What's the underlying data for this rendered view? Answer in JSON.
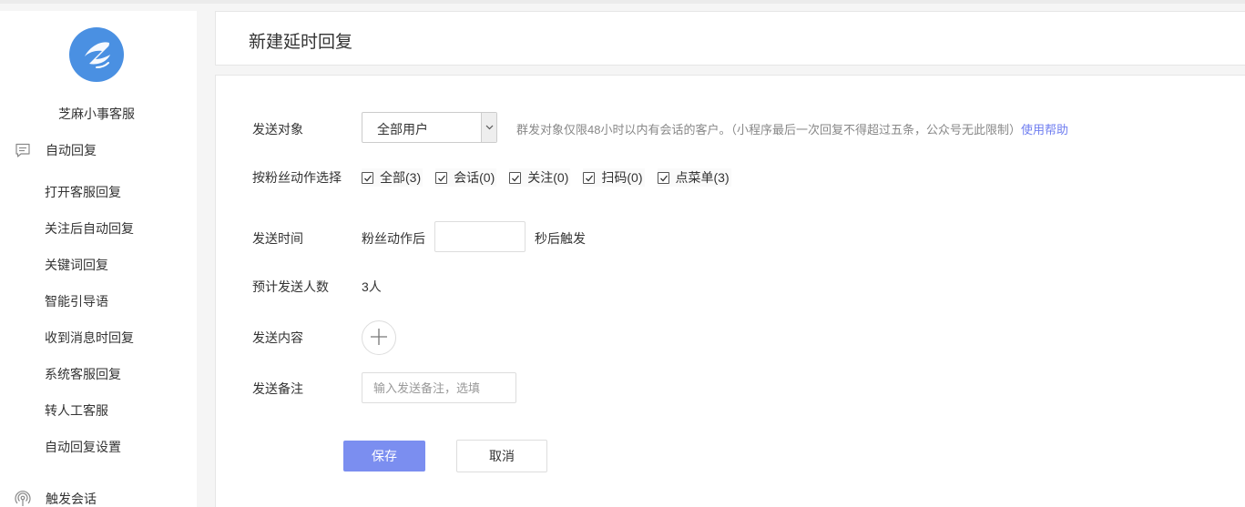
{
  "colors": {
    "accent": "#7b8ef0",
    "link": "#6f7ef0",
    "logo": "#4a90e2"
  },
  "sidebar": {
    "brand": "芝麻小事客服",
    "groups": [
      {
        "label": "自动回复",
        "icon": "chat-list-icon"
      },
      {
        "label": "触发会话",
        "icon": "broadcast-icon"
      }
    ],
    "items": [
      {
        "label": "打开客服回复"
      },
      {
        "label": "关注后自动回复"
      },
      {
        "label": "关键词回复"
      },
      {
        "label": "智能引导语"
      },
      {
        "label": "收到消息时回复"
      },
      {
        "label": "系统客服回复"
      },
      {
        "label": "转人工客服"
      },
      {
        "label": "自动回复设置"
      }
    ]
  },
  "header": {
    "title": "新建延时回复"
  },
  "form": {
    "target": {
      "label": "发送对象",
      "selected": "全部用户",
      "hint": "群发对象仅限48小时以内有会话的客户。（小程序最后一次回复不得超过五条，公众号无此限制）",
      "help_link": "使用帮助"
    },
    "action_filter": {
      "label": "按粉丝动作选择",
      "options": [
        {
          "label": "全部(3)",
          "checked": true
        },
        {
          "label": "会话(0)",
          "checked": true
        },
        {
          "label": "关注(0)",
          "checked": true
        },
        {
          "label": "扫码(0)",
          "checked": true
        },
        {
          "label": "点菜单(3)",
          "checked": true
        }
      ]
    },
    "send_time": {
      "label": "发送时间",
      "prefix": "粉丝动作后",
      "value": "",
      "suffix": "秒后触发"
    },
    "estimate": {
      "label": "预计发送人数",
      "value": "3人"
    },
    "content": {
      "label": "发送内容"
    },
    "remark": {
      "label": "发送备注",
      "placeholder": "输入发送备注，选填"
    },
    "buttons": {
      "save": "保存",
      "cancel": "取消"
    }
  }
}
